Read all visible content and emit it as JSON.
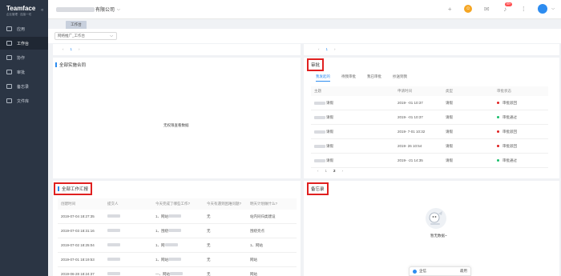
{
  "brand": {
    "name": "Teamface",
    "tagline": "企业管理 · 连接一切"
  },
  "sidebar": {
    "items": [
      {
        "label": "应用",
        "icon": "grid-icon"
      },
      {
        "label": "工作台",
        "icon": "desktop-icon",
        "active": true
      },
      {
        "label": "协作",
        "icon": "collab-icon"
      },
      {
        "label": "审批",
        "icon": "approval-icon"
      },
      {
        "label": "备忘录",
        "icon": "memo-icon"
      },
      {
        "label": "文件库",
        "icon": "folder-icon"
      }
    ]
  },
  "header": {
    "company_suffix": "有限公司",
    "badge_count": "99+"
  },
  "tabs": {
    "active": "工作台"
  },
  "select": {
    "value": "网络推广_工作台"
  },
  "pager_top_left": {
    "page": "1"
  },
  "pager_top_right": {
    "page": "1"
  },
  "panels": {
    "contracts": {
      "title": "全部实施合同",
      "empty": "无权限查看数据"
    },
    "approval": {
      "title": "审批",
      "subtabs": [
        "我发起的",
        "待我审批",
        "我已审批",
        "抄送到我"
      ],
      "columns": [
        "主题",
        "申请时间",
        "类型",
        "审批状态"
      ],
      "rows": [
        {
          "subject": "请假",
          "time": "2019-  -01 10:37",
          "type": "请假",
          "status": "审批驳回",
          "color": "#e02020"
        },
        {
          "subject": "请假",
          "time": "2019-  -01 10:37",
          "type": "请假",
          "status": "审批通过",
          "color": "#19be6b"
        },
        {
          "subject": "请假",
          "time": "2019-  7-01 10:32",
          "type": "请假",
          "status": "审批驳回",
          "color": "#e02020"
        },
        {
          "subject": "请假",
          "time": "2019-  26 10:54",
          "type": "请假",
          "status": "审批驳回",
          "color": "#e02020"
        },
        {
          "subject": "请假",
          "time": "2019-  -21 14:35",
          "type": "请假",
          "status": "审批通过",
          "color": "#19be6b"
        }
      ],
      "pages": [
        "1",
        "2"
      ]
    },
    "reports": {
      "title": "全部工作汇报",
      "columns": [
        "创建时间",
        "提交人",
        "今天完成了哪些工作?",
        "今天有遇到困难问题?",
        "明天计划做什么?"
      ],
      "rows": [
        {
          "time": "2019-07-04 18:27:35",
          "done": "1、网站",
          "problem": "无",
          "plan": "站内同归类建设"
        },
        {
          "time": "2019-07-03 18:31:16",
          "done": "1、围绕",
          "problem": "无",
          "plan": "围绕亮点"
        },
        {
          "time": "2019-07-02 18:25:04",
          "done": "1、网",
          "problem": "无",
          "plan": "1、网站"
        },
        {
          "time": "2019-07-01 18:19:53",
          "done": "1、网站",
          "problem": "无",
          "plan": "网站"
        },
        {
          "time": "2019-06-28 18:24:37",
          "done": "—、网站",
          "problem": "无",
          "plan": "网站"
        }
      ]
    },
    "memo": {
      "title": "备忘录",
      "empty": "暂无数据~"
    }
  },
  "chatbar": {
    "label": "企信",
    "right": "最用"
  }
}
